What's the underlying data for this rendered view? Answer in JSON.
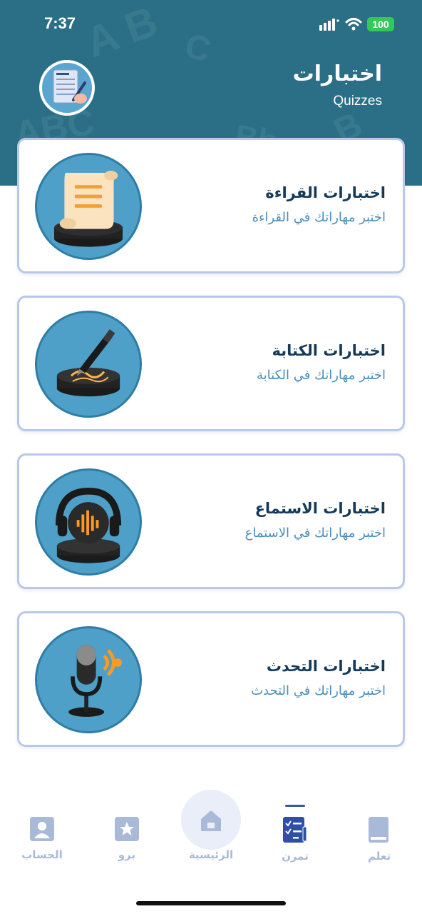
{
  "status_bar": {
    "time": "7:37",
    "battery": "100"
  },
  "header": {
    "title": "اختبارات",
    "subtitle": "Quizzes"
  },
  "cards": [
    {
      "title": "اختبارات القراءة",
      "subtitle": "اختبر مهاراتك في القراءة",
      "icon": "scroll-icon"
    },
    {
      "title": "اختبارات الكتابة",
      "subtitle": "اختبر مهاراتك في الكتابة",
      "icon": "pen-icon"
    },
    {
      "title": "اختبارات الاستماع",
      "subtitle": "اختبر مهاراتك في الاستماع",
      "icon": "headphones-icon"
    },
    {
      "title": "اختبارات التحدث",
      "subtitle": "اختبر مهاراتك في التحدث",
      "icon": "microphone-icon"
    }
  ],
  "nav": {
    "account": "الحساب",
    "pro": "برو",
    "home": "الرئيسية",
    "practice": "تمرن",
    "learn": "تعلم"
  },
  "colors": {
    "header_bg": "#2b6f86",
    "card_border": "#b7c8ea",
    "icon_circle": "#4ea0c8",
    "title_text": "#143a5a",
    "subtitle_text": "#4a8db8",
    "nav_inactive": "#a9bad8",
    "nav_active": "#1f3a6e"
  }
}
